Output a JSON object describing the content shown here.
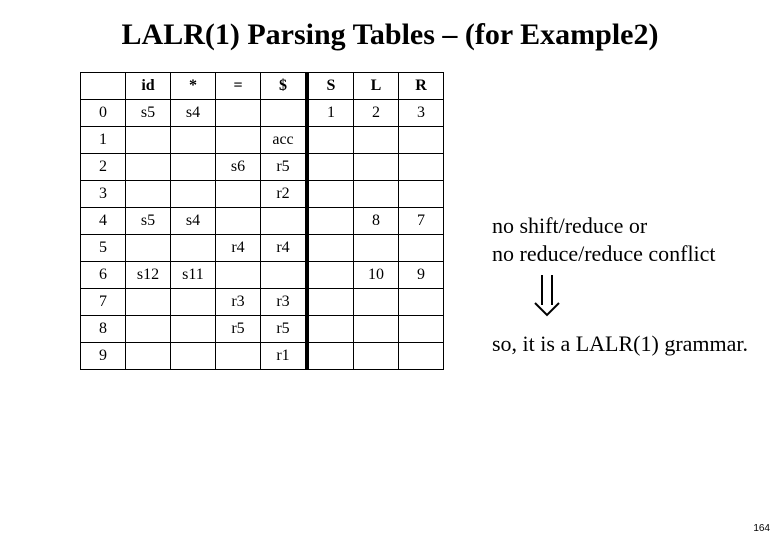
{
  "title": "LALR(1) Parsing Tables – (for Example2)",
  "columns": [
    "",
    "id",
    "*",
    "=",
    "$",
    "S",
    "L",
    "R"
  ],
  "rows": [
    {
      "st": "0",
      "id": "s5",
      "star": "s4",
      "eq": "",
      "dol": "",
      "S": "1",
      "L": "2",
      "R": "3"
    },
    {
      "st": "1",
      "id": "",
      "star": "",
      "eq": "",
      "dol": "acc",
      "S": "",
      "L": "",
      "R": ""
    },
    {
      "st": "2",
      "id": "",
      "star": "",
      "eq": "s6",
      "dol": "r5",
      "S": "",
      "L": "",
      "R": ""
    },
    {
      "st": "3",
      "id": "",
      "star": "",
      "eq": "",
      "dol": "r2",
      "S": "",
      "L": "",
      "R": ""
    },
    {
      "st": "4",
      "id": "s5",
      "star": "s4",
      "eq": "",
      "dol": "",
      "S": "",
      "L": "8",
      "R": "7"
    },
    {
      "st": "5",
      "id": "",
      "star": "",
      "eq": "r4",
      "dol": "r4",
      "S": "",
      "L": "",
      "R": ""
    },
    {
      "st": "6",
      "id": "s12",
      "star": "s11",
      "eq": "",
      "dol": "",
      "S": "",
      "L": "10",
      "R": "9"
    },
    {
      "st": "7",
      "id": "",
      "star": "",
      "eq": "r3",
      "dol": "r3",
      "S": "",
      "L": "",
      "R": ""
    },
    {
      "st": "8",
      "id": "",
      "star": "",
      "eq": "r5",
      "dol": "r5",
      "S": "",
      "L": "",
      "R": ""
    },
    {
      "st": "9",
      "id": "",
      "star": "",
      "eq": "",
      "dol": "r1",
      "S": "",
      "L": "",
      "R": ""
    }
  ],
  "note1_line1": "no shift/reduce or",
  "note1_line2": "no reduce/reduce conflict",
  "note2": "so, it is a LALR(1) grammar.",
  "pagenum": "164"
}
